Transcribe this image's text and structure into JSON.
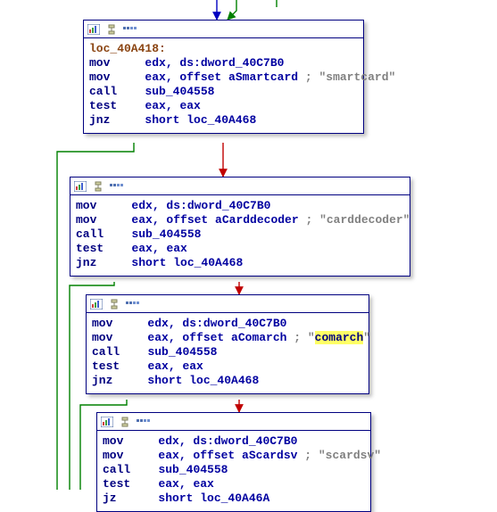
{
  "icons": {
    "chart": "chart-icon",
    "flow": "flow-icon",
    "hex": "hex-icon"
  },
  "search_highlight": "comarch",
  "nodes": [
    {
      "id": "n1",
      "label": "loc_40A418:",
      "lines": [
        {
          "op": "mov",
          "args": "edx, ds:dword_40C7B0"
        },
        {
          "op": "mov",
          "args": "eax, offset aSmartcard",
          "cmt": "; \"smartcard\""
        },
        {
          "op": "call",
          "args": "sub_404558"
        },
        {
          "op": "test",
          "args": "eax, eax"
        },
        {
          "op": "jnz",
          "args": "short loc_40A468"
        }
      ]
    },
    {
      "id": "n2",
      "lines": [
        {
          "op": "mov",
          "args": "edx, ds:dword_40C7B0"
        },
        {
          "op": "mov",
          "args": "eax, offset aCarddecoder",
          "cmt": "; \"carddecoder\""
        },
        {
          "op": "call",
          "args": "sub_404558"
        },
        {
          "op": "test",
          "args": "eax, eax"
        },
        {
          "op": "jnz",
          "args": "short loc_40A468"
        }
      ]
    },
    {
      "id": "n3",
      "lines": [
        {
          "op": "mov",
          "args": "edx, ds:dword_40C7B0"
        },
        {
          "op": "mov",
          "args": "eax, offset aComarch",
          "cmt": "; \"",
          "cmt_hl": "comarch",
          "cmt_tail": "\""
        },
        {
          "op": "call",
          "args": "sub_404558"
        },
        {
          "op": "test",
          "args": "eax, eax"
        },
        {
          "op": "jnz",
          "args": "short loc_40A468"
        }
      ]
    },
    {
      "id": "n4",
      "lines": [
        {
          "op": "mov",
          "args": "edx, ds:dword_40C7B0"
        },
        {
          "op": "mov",
          "args": "eax, offset aScardsv",
          "cmt": "; \"scardsv\""
        },
        {
          "op": "call",
          "args": "sub_404558"
        },
        {
          "op": "test",
          "args": "eax, eax"
        },
        {
          "op": "jz",
          "args": "short loc_40A46A"
        }
      ]
    }
  ]
}
